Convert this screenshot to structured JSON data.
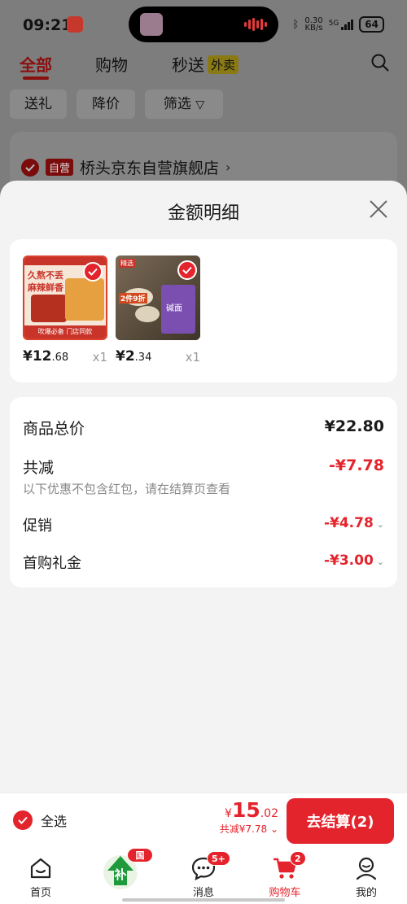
{
  "status_bar": {
    "time": "09:21",
    "network_speed": "0.30",
    "network_unit": "KB/s",
    "signal": "5G",
    "battery": "64"
  },
  "top_tabs": [
    {
      "label": "全部"
    },
    {
      "label": "购物"
    },
    {
      "label": "秒送",
      "badge": "外卖"
    }
  ],
  "filter_chips": [
    {
      "label": "送礼"
    },
    {
      "label": "降价"
    },
    {
      "label": "筛选"
    }
  ],
  "store": {
    "tag": "自营",
    "name": "桥头京东自营旗舰店"
  },
  "sheet": {
    "title": "金额明细",
    "products": [
      {
        "price_main": "¥12",
        "price_dec": ".68",
        "qty": "x1",
        "img_text_1": "久熬不丢",
        "img_text_2": "麻辣鲜香",
        "img_footer": "吹爆必备 门店同款"
      },
      {
        "price_main": "¥2",
        "price_dec": ".34",
        "qty": "x1",
        "img_tag": "精选",
        "img_promo": "2件9折",
        "img_pack": "碱面"
      }
    ],
    "summary": {
      "total_label": "商品总价",
      "total_value": "¥22.80",
      "reduce_label": "共减",
      "reduce_value": "-¥7.78",
      "note": "以下优惠不包含红包，请在结算页查看",
      "promo_label": "促销",
      "promo_value": "-¥4.78",
      "gift_label": "首购礼金",
      "gift_value": "-¥3.00"
    }
  },
  "checkout": {
    "select_all": "全选",
    "currency": "¥",
    "total_int": "15",
    "total_dec": ".02",
    "saved": "共减¥7.78",
    "pay_button": "去结算(2)"
  },
  "bottom_nav": [
    {
      "label": "首页"
    },
    {
      "label": "",
      "badge": "国补"
    },
    {
      "label": "消息",
      "badge": "5+"
    },
    {
      "label": "购物车",
      "badge": "2"
    },
    {
      "label": "我的"
    }
  ],
  "colors": {
    "accent": "#e4242d",
    "dim_accent": "#8a1010",
    "sheet_bg": "#f3f3f3"
  }
}
